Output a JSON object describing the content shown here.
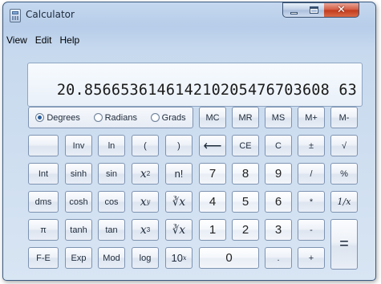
{
  "window": {
    "title": "Calculator"
  },
  "menu": [
    "View",
    "Edit",
    "Help"
  ],
  "display": {
    "value": "20.856653614614210205476703608 63"
  },
  "angle_units": {
    "options": [
      "Degrees",
      "Radians",
      "Grads"
    ],
    "selected": "Degrees"
  },
  "memory": [
    "MC",
    "MR",
    "MS",
    "M+",
    "M-"
  ],
  "buttons": {
    "inv": "Inv",
    "ln": "ln",
    "lparen": "(",
    "rparen": ")",
    "backspace": "⟵",
    "ce": "CE",
    "c": "C",
    "pm": "±",
    "sqrt": "√",
    "int": "Int",
    "sinh": "sinh",
    "sin": "sin",
    "x2_base": "x",
    "x2_sup": "2",
    "fact": "n!",
    "n7": "7",
    "n8": "8",
    "n9": "9",
    "div": "/",
    "pct": "%",
    "dms": "dms",
    "cosh": "cosh",
    "cos": "cos",
    "xy_base": "x",
    "xy_sup": "y",
    "yroot_pre": "∛",
    "yroot_x": "x",
    "n4": "4",
    "n5": "5",
    "n6": "6",
    "mul": "*",
    "recip": "1/x",
    "pi": "π",
    "tanh": "tanh",
    "tan": "tan",
    "x3_base": "x",
    "x3_sup": "3",
    "cbrt_pre": "∛",
    "cbrt_x": "x",
    "n1": "1",
    "n2": "2",
    "n3": "3",
    "sub": "-",
    "eq": "=",
    "fe": "F-E",
    "exp": "Exp",
    "mod": "Mod",
    "log": "log",
    "ten_base": "10",
    "ten_sup": "x",
    "n0": "0",
    "dot": ".",
    "add": "+"
  }
}
